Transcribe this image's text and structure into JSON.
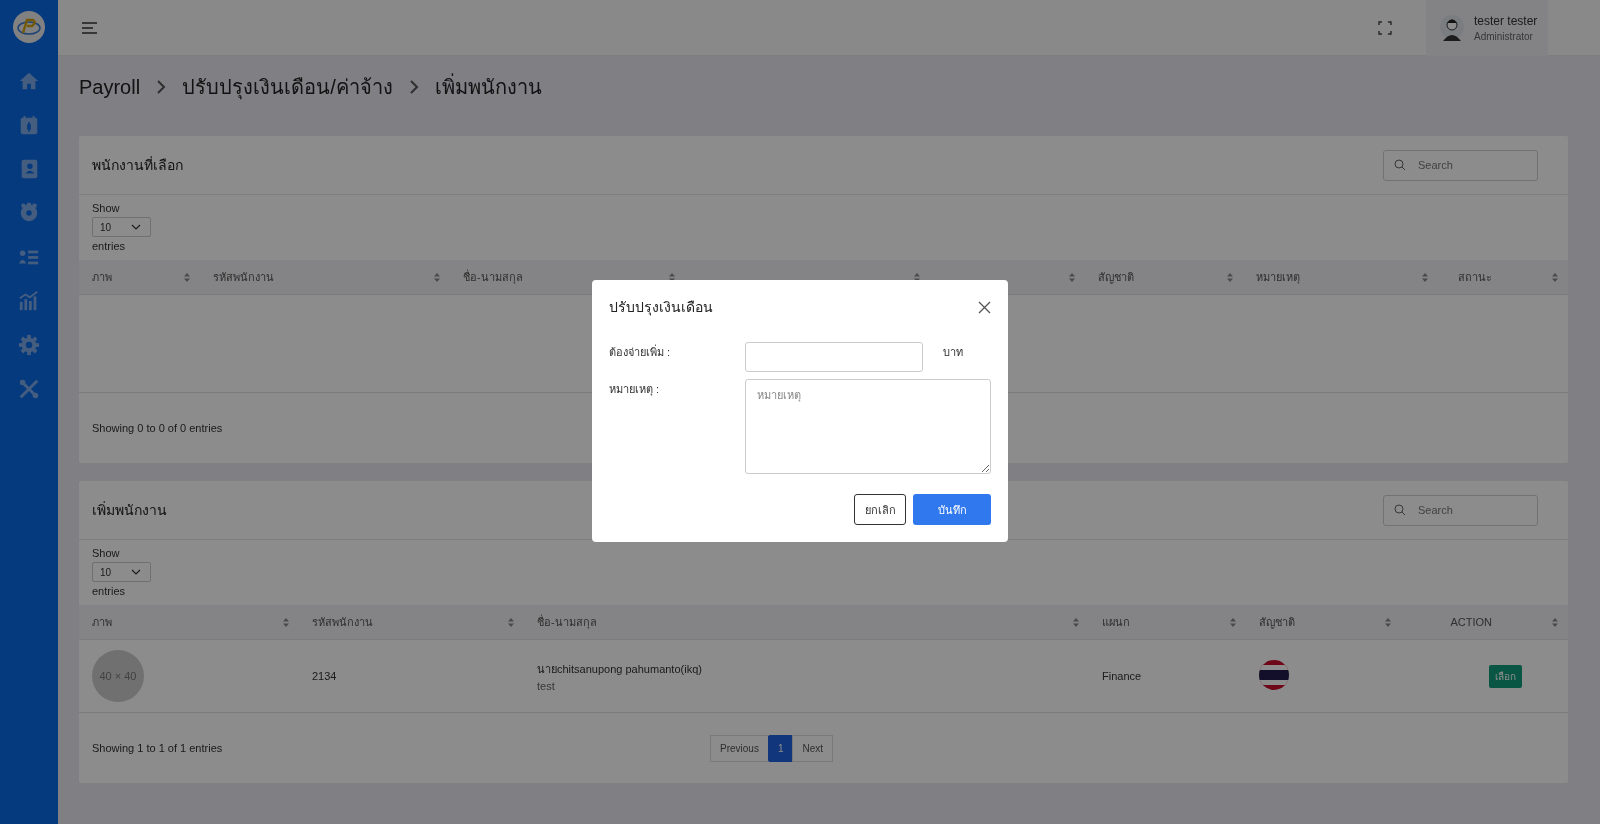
{
  "topbar": {
    "user_name": "tester tester",
    "user_role": "Administrator"
  },
  "breadcrumb": [
    "Payroll",
    "ปรับปรุงเงินเดือน/ค่าจ้าง",
    "เพิ่มพนักงาน"
  ],
  "selected_card": {
    "title": "พนักงานที่เลือก",
    "search_placeholder": "Search",
    "show_label": "Show",
    "page_size": "10",
    "entries_label": "entries",
    "columns": [
      "ภาพ",
      "รหัสพนักงาน",
      "ชื่อ-นามสกุล",
      "สัญชาติ",
      "หมายเหตุ",
      "สถานะ"
    ],
    "info": "Showing 0 to 0 of 0 entries"
  },
  "add_card": {
    "title": "เพิ่มพนักงาน",
    "search_placeholder": "Search",
    "show_label": "Show",
    "page_size": "10",
    "entries_label": "entries",
    "columns": [
      "ภาพ",
      "รหัสพนักงาน",
      "ชื่อ-นามสกุล",
      "แผนก",
      "สัญชาติ",
      "ACTION"
    ],
    "rows": [
      {
        "photo": "40 × 40",
        "code": "2134",
        "name": "นายchitsanupong pahumanto(ikq)",
        "note": "test",
        "department": "Finance",
        "action": "เลือก"
      }
    ],
    "info": "Showing 1 to 1 of 1 entries",
    "pagination": [
      {
        "label": "Previous",
        "selected": false
      },
      {
        "label": "1",
        "selected": true
      },
      {
        "label": "Next",
        "selected": false
      }
    ]
  },
  "modal": {
    "title": "ปรับปรุงเงินเดือน",
    "fields": [
      {
        "kind": "input",
        "label": "ต้องจ่ายเพิ่ม :",
        "unit": "บาท"
      },
      {
        "kind": "textarea",
        "label": "หมายเหตุ :",
        "placeholder": "หมายเหตุ"
      }
    ],
    "buttons": [
      {
        "label": "ยกเลิก",
        "kind": "secondary"
      },
      {
        "label": "บันทึก",
        "kind": "primary"
      }
    ]
  }
}
